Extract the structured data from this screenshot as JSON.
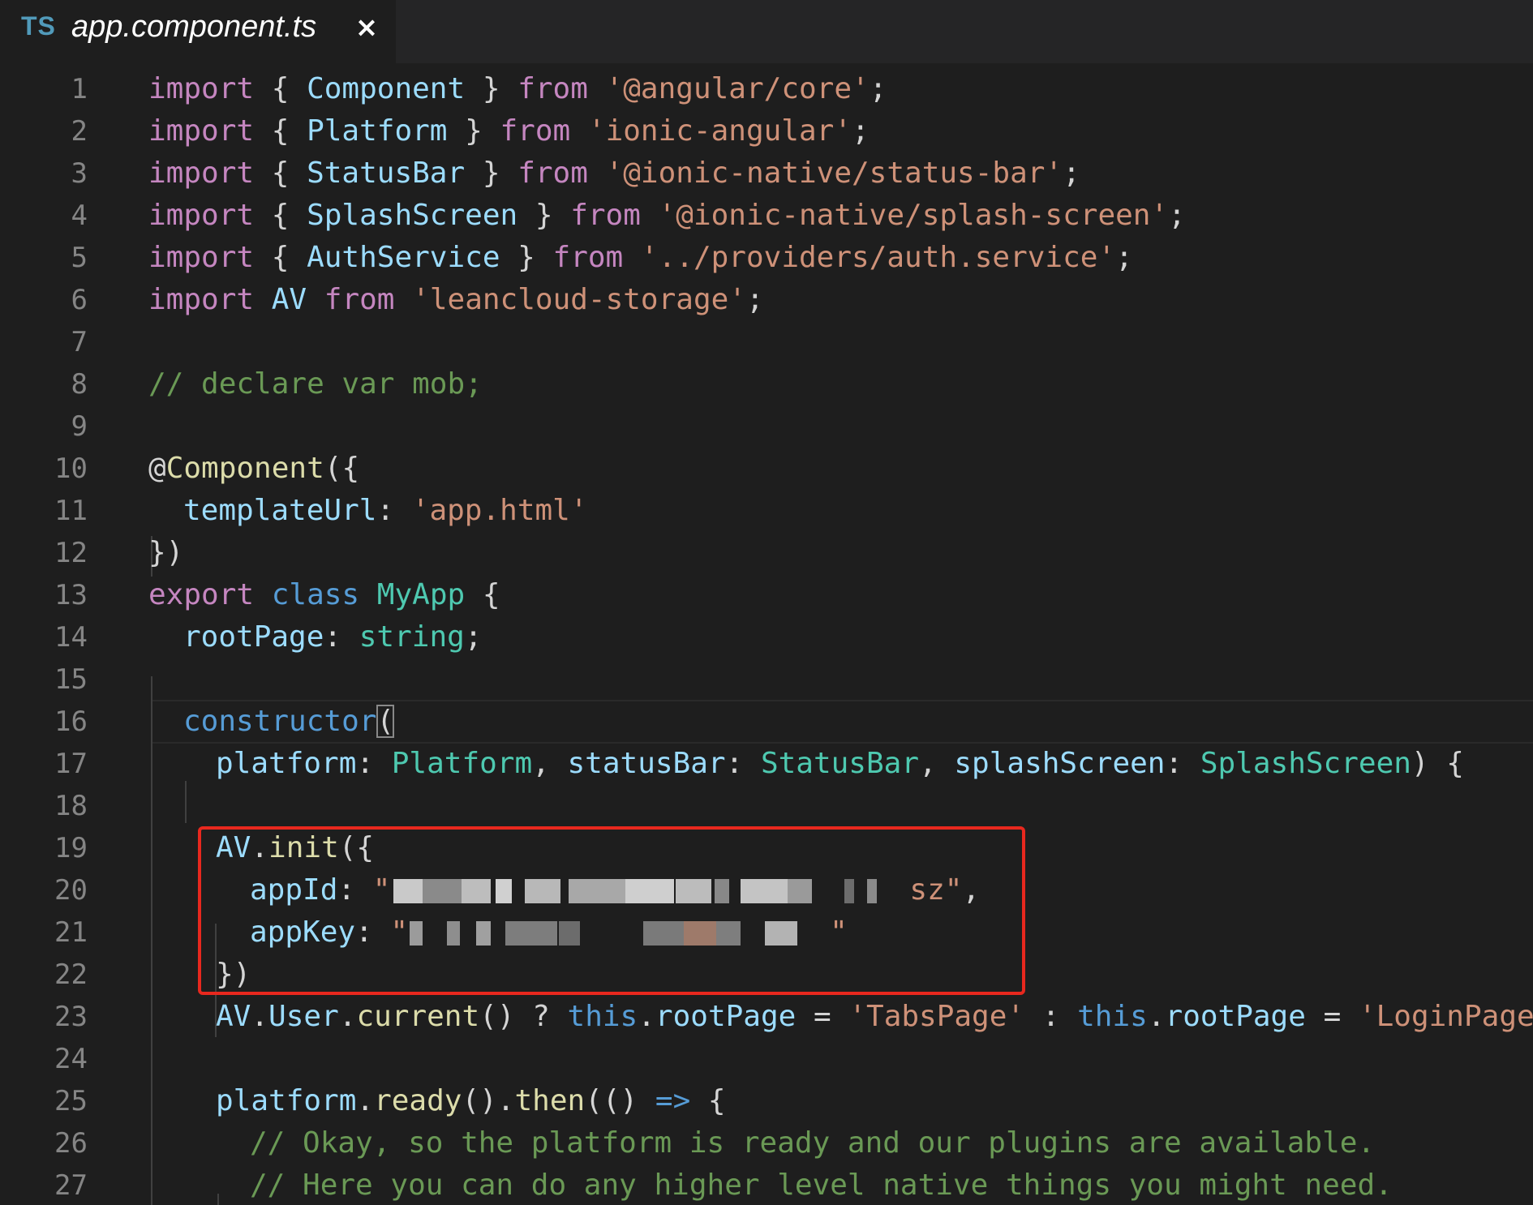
{
  "tab": {
    "icon_label": "TS",
    "title": "app.component.ts",
    "close_glyph": "×"
  },
  "editor": {
    "line_numbers": [
      "1",
      "2",
      "3",
      "4",
      "5",
      "6",
      "7",
      "8",
      "9",
      "10",
      "11",
      "12",
      "13",
      "14",
      "15",
      "16",
      "17",
      "18",
      "19",
      "20",
      "21",
      "22",
      "23",
      "24",
      "25",
      "26",
      "27"
    ],
    "code": {
      "l1": [
        "import",
        " { ",
        "Component",
        " } ",
        "from",
        " ",
        "'@angular/core'",
        ";"
      ],
      "l2": [
        "import",
        " { ",
        "Platform",
        " } ",
        "from",
        " ",
        "'ionic-angular'",
        ";"
      ],
      "l3": [
        "import",
        " { ",
        "StatusBar",
        " } ",
        "from",
        " ",
        "'@ionic-native/status-bar'",
        ";"
      ],
      "l4": [
        "import",
        " { ",
        "SplashScreen",
        " } ",
        "from",
        " ",
        "'@ionic-native/splash-screen'",
        ";"
      ],
      "l5": [
        "import",
        " { ",
        "AuthService",
        " } ",
        "from",
        " ",
        "'../providers/auth.service'",
        ";"
      ],
      "l6": [
        "import",
        " ",
        "AV",
        " ",
        "from",
        " ",
        "'leancloud-storage'",
        ";"
      ],
      "l8": [
        "// declare var mob;"
      ],
      "l10": [
        "@",
        "Component",
        "({"
      ],
      "l11": [
        "templateUrl",
        ": ",
        "'app.html'"
      ],
      "l12": [
        "})"
      ],
      "l13": [
        "export",
        " ",
        "class",
        " ",
        "MyApp",
        " {"
      ],
      "l14": [
        "rootPage",
        ": ",
        "string",
        ";"
      ],
      "l16": [
        "constructor",
        "("
      ],
      "l17": [
        "platform",
        ": ",
        "Platform",
        ", ",
        "statusBar",
        ": ",
        "StatusBar",
        ", ",
        "splashScreen",
        ": ",
        "SplashScreen",
        ") {"
      ],
      "l19": [
        "AV",
        ".",
        "init",
        "({"
      ],
      "l20": [
        "appId",
        ": ",
        "\"",
        "sz\"",
        ","
      ],
      "l21": [
        "appKey",
        ": ",
        "\"",
        "\""
      ],
      "l22": [
        "})"
      ],
      "l23": [
        "AV",
        ".",
        "User",
        ".",
        "current",
        "() ? ",
        "this",
        ".",
        "rootPage",
        " = ",
        "'TabsPage'",
        " : ",
        "this",
        ".",
        "rootPage",
        " = ",
        "'LoginPage'",
        ";"
      ],
      "l25": [
        "platform",
        ".",
        "ready",
        "().",
        "then",
        "(() ",
        "=>",
        " {"
      ],
      "l26": [
        "// Okay, so the platform is ready and our plugins are available."
      ],
      "l27": [
        "// Here you can do any higher level native things you might need."
      ]
    }
  },
  "colors": {
    "background": "#1e1e1e",
    "keyword": "#c586c0",
    "storage": "#569cd6",
    "type": "#4ec9b0",
    "variable": "#9cdcfe",
    "string": "#ce9178",
    "comment": "#6a9955",
    "function": "#dcdcaa",
    "annotation_box": "#e8281e"
  }
}
